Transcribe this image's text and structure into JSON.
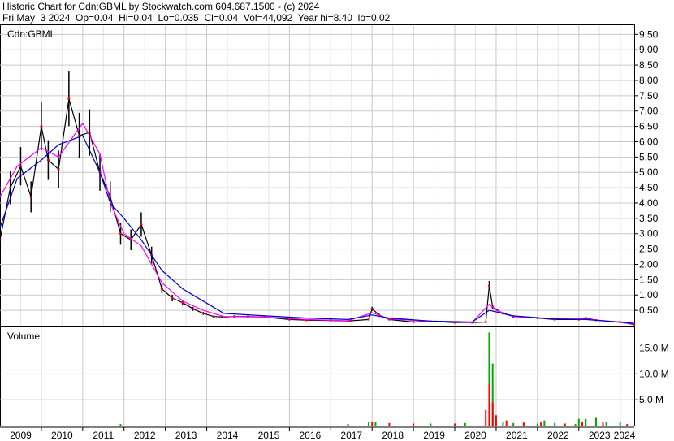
{
  "header": {
    "line1": "Historic Chart for Cdn:GBML by Stockwatch.com 604.687.1500 - (c) 2024",
    "line2": "Fri May  3 2024  Op=0.04  Hi=0.04  Lo=0.035  Cl=0.04  Vol=44,092  Year hi=8.40  lo=0.02"
  },
  "colors": {
    "price_bars": "#000000",
    "close_dots": "#ff0000",
    "ma_short": "#ff00ff",
    "ma_long": "#0000cc",
    "volume_up": "#00aa00",
    "volume_down": "#ff0000",
    "grid": "#c8c8c8"
  },
  "chart_data": [
    {
      "type": "line",
      "symbol_label": "Cdn:GBML",
      "y_tick_labels": [
        "9.50",
        "9.00",
        "8.50",
        "8.00",
        "7.50",
        "7.00",
        "6.50",
        "6.00",
        "5.50",
        "5.00",
        "4.50",
        "4.00",
        "3.50",
        "3.00",
        "2.50",
        "2.00",
        "1.50",
        "1.00",
        "0.50"
      ],
      "ylim": [
        0,
        9.8
      ],
      "x_tick_labels": [
        "2009",
        "2010",
        "2011",
        "2012",
        "2013",
        "2014",
        "2015",
        "2016",
        "2017",
        "2018",
        "2019",
        "2020",
        "2021",
        "2022",
        "2023",
        "2024"
      ],
      "grid": true,
      "series": [
        {
          "kind": "price",
          "x": [
            "2009-01",
            "2009-04",
            "2009-07",
            "2009-10",
            "2010-01",
            "2010-03",
            "2010-06",
            "2010-09",
            "2010-12",
            "2011-03",
            "2011-06",
            "2011-09",
            "2011-12",
            "2012-03",
            "2012-06",
            "2012-09",
            "2012-12",
            "2013-03",
            "2013-06",
            "2013-09",
            "2013-12",
            "2014-03",
            "2014-06",
            "2014-09",
            "2015-01",
            "2015-06",
            "2016-01",
            "2016-06",
            "2017-01",
            "2017-06",
            "2017-12",
            "2018-01",
            "2018-03",
            "2018-06",
            "2019-01",
            "2019-06",
            "2020-01",
            "2020-06",
            "2020-10",
            "2020-11",
            "2020-12",
            "2021-03",
            "2021-06",
            "2022-01",
            "2022-06",
            "2023-01",
            "2023-03",
            "2023-06",
            "2024-01",
            "2024-05"
          ],
          "y": [
            2.8,
            4.5,
            5.2,
            4.2,
            6.5,
            5.4,
            5.1,
            7.4,
            6.2,
            6.3,
            5.0,
            4.2,
            3.0,
            2.8,
            3.3,
            2.3,
            1.2,
            0.9,
            0.75,
            0.55,
            0.4,
            0.3,
            0.28,
            0.3,
            0.3,
            0.28,
            0.2,
            0.18,
            0.17,
            0.15,
            0.2,
            0.55,
            0.35,
            0.2,
            0.12,
            0.14,
            0.1,
            0.1,
            0.12,
            1.3,
            0.6,
            0.4,
            0.3,
            0.25,
            0.2,
            0.2,
            0.25,
            0.18,
            0.12,
            0.04
          ]
        },
        {
          "kind": "ma_short",
          "x": [
            "2009-01",
            "2009-06",
            "2010-01",
            "2010-06",
            "2011-01",
            "2011-06",
            "2011-09",
            "2012-01",
            "2012-06",
            "2012-12",
            "2013-06",
            "2013-12",
            "2014-06",
            "2015-06",
            "2016-06",
            "2017-06",
            "2018-01",
            "2018-06",
            "2019-06",
            "2020-06",
            "2020-11",
            "2021-01",
            "2021-06",
            "2022-06",
            "2023-03",
            "2024-05"
          ],
          "y": [
            4.2,
            5.2,
            5.8,
            5.5,
            6.6,
            5.6,
            4.0,
            3.0,
            2.6,
            1.4,
            0.8,
            0.5,
            0.3,
            0.28,
            0.2,
            0.16,
            0.42,
            0.22,
            0.14,
            0.1,
            0.7,
            0.5,
            0.3,
            0.22,
            0.22,
            0.06
          ]
        },
        {
          "kind": "ma_long",
          "x": [
            "2009-01",
            "2009-06",
            "2010-01",
            "2010-06",
            "2011-01",
            "2011-06",
            "2011-09",
            "2012-01",
            "2012-06",
            "2012-12",
            "2013-06",
            "2013-12",
            "2014-06",
            "2015-06",
            "2016-06",
            "2017-06",
            "2018-01",
            "2018-06",
            "2019-06",
            "2020-06",
            "2020-11",
            "2021-01",
            "2021-06",
            "2022-06",
            "2023-03",
            "2024-05"
          ],
          "y": [
            3.2,
            4.8,
            5.4,
            5.9,
            6.2,
            5.0,
            4.0,
            3.5,
            2.8,
            1.8,
            1.2,
            0.8,
            0.4,
            0.32,
            0.25,
            0.2,
            0.35,
            0.25,
            0.15,
            0.12,
            0.5,
            0.45,
            0.32,
            0.22,
            0.2,
            0.08
          ]
        }
      ]
    },
    {
      "type": "bar",
      "title": "Volume",
      "y_tick_labels": [
        "15.0 M",
        "10.0 M",
        "5.0 M"
      ],
      "ylim": [
        0,
        19
      ],
      "x_tick_labels": [
        "2009",
        "2010",
        "2011",
        "2012",
        "2013",
        "2014",
        "2015",
        "2016",
        "2017",
        "2018",
        "2019",
        "2020",
        "2021",
        "2022",
        "2023",
        "2024"
      ],
      "series": [
        {
          "name": "up",
          "x": [
            "2011-12",
            "2017-12",
            "2018-02",
            "2019-06",
            "2020-04",
            "2020-11",
            "2020-12",
            "2021-03",
            "2021-06",
            "2022-01",
            "2022-03",
            "2022-06",
            "2022-12",
            "2023-01",
            "2023-03",
            "2023-06",
            "2023-09",
            "2024-01"
          ],
          "values": [
            0.3,
            0.6,
            0.8,
            0.4,
            0.5,
            18.0,
            12.0,
            0.6,
            0.5,
            0.4,
            1.0,
            0.5,
            0.3,
            1.3,
            1.3,
            1.5,
            0.8,
            0.6
          ]
        },
        {
          "name": "down",
          "x": [
            "2017-06",
            "2018-01",
            "2018-06",
            "2019-01",
            "2020-01",
            "2020-10",
            "2020-11",
            "2020-12",
            "2021-01",
            "2021-04",
            "2021-09",
            "2022-02",
            "2022-09",
            "2023-02",
            "2023-08",
            "2024-03"
          ],
          "values": [
            0.3,
            0.7,
            0.5,
            0.4,
            0.4,
            3.0,
            8.0,
            4.5,
            2.0,
            1.0,
            0.6,
            0.6,
            0.4,
            0.8,
            0.6,
            0.3
          ]
        }
      ]
    }
  ]
}
